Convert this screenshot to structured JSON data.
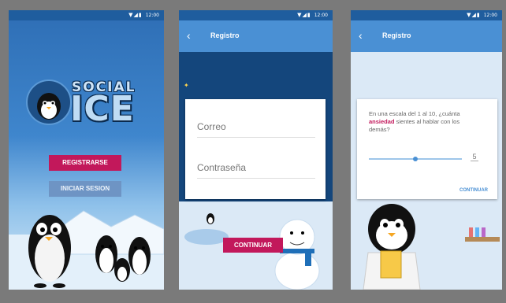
{
  "status_bar": {
    "icons": "▼◢▮",
    "time": "12:00"
  },
  "screen1": {
    "logo_top": "SOCIAL",
    "logo_main": "ICE",
    "register_label": "REGISTRARSE",
    "login_label": "INICIAR SESION"
  },
  "screen2": {
    "title": "Registro",
    "email_placeholder": "Correo",
    "password_placeholder": "Contraseña",
    "continue_label": "CONTINUAR"
  },
  "screen3": {
    "title": "Registro",
    "question_pre": "En una escala del 1 al 10, ¿cuánta",
    "question_highlight": "ansiedad",
    "question_post": "sientes al hablar con los demás?",
    "slider_value": "5",
    "slider_fraction": 0.5,
    "continue_label": "CONTINUAR"
  },
  "colors": {
    "primary": "#4a90d4",
    "accent": "#c2185b",
    "dark_blue": "#14467c"
  }
}
